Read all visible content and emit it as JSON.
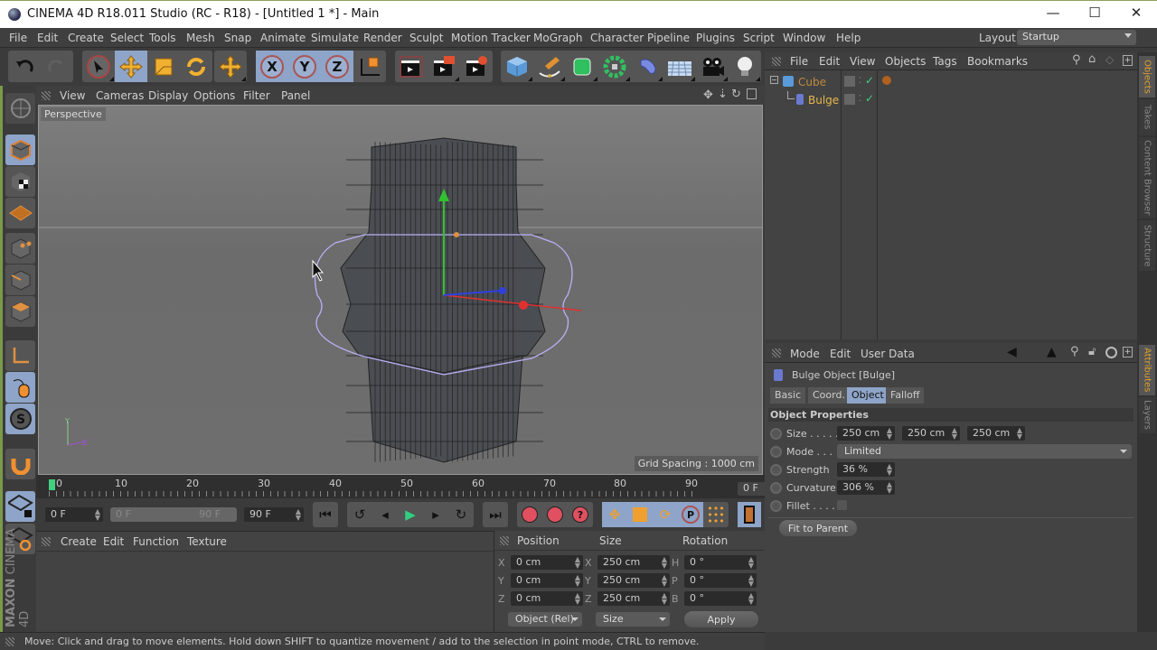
{
  "window": {
    "title": "CINEMA 4D R18.011 Studio (RC - R18) - [Untitled 1 *] - Main",
    "minimize": "—",
    "maximize": "☐",
    "close": "✕"
  },
  "menubar": {
    "items": [
      "File",
      "Edit",
      "Create",
      "Select",
      "Tools",
      "Mesh",
      "Snap",
      "Animate",
      "Simulate",
      "Render",
      "Sculpt",
      "Motion Tracker",
      "MoGraph",
      "Character",
      "Pipeline",
      "Plugins",
      "Script",
      "Window",
      "Help"
    ],
    "layout_label": "Layout:",
    "layout_value": "Startup"
  },
  "toolbar": {
    "axis_x": "X",
    "axis_y": "Y",
    "axis_z": "Z"
  },
  "viewport": {
    "menu": [
      "View",
      "Cameras",
      "Display",
      "Options",
      "Filter",
      "Panel"
    ],
    "camera_label": "Perspective",
    "grid_spacing": "Grid Spacing : 1000 cm",
    "axis_y_label": "Y",
    "axis_z_label": "Z"
  },
  "timeline": {
    "ticks": [
      "0",
      "10",
      "20",
      "30",
      "40",
      "50",
      "60",
      "70",
      "80",
      "90"
    ],
    "current_frame": "0 F",
    "start_field": "0 F",
    "range_start": "0 F",
    "range_end": "90 F",
    "end_field": "90 F"
  },
  "material_manager": {
    "menu": [
      "Create",
      "Edit",
      "Function",
      "Texture"
    ]
  },
  "coordinates": {
    "headers": [
      "Position",
      "Size",
      "Rotation"
    ],
    "rows": [
      {
        "pos_axis": "X",
        "pos": "0 cm",
        "size_axis": "X",
        "size": "250 cm",
        "rot_axis": "H",
        "rot": "0 °"
      },
      {
        "pos_axis": "Y",
        "pos": "0 cm",
        "size_axis": "Y",
        "size": "250 cm",
        "rot_axis": "P",
        "rot": "0 °"
      },
      {
        "pos_axis": "Z",
        "pos": "0 cm",
        "size_axis": "Z",
        "size": "250 cm",
        "rot_axis": "B",
        "rot": "0 °"
      }
    ],
    "mode_select": "Object (Rel)",
    "size_select": "Size",
    "apply": "Apply"
  },
  "status": {
    "text": "Move: Click and drag to move elements. Hold down SHIFT to quantize movement / add to the selection in point mode, CTRL to remove."
  },
  "object_manager": {
    "menu": [
      "File",
      "Edit",
      "View",
      "Objects",
      "Tags",
      "Bookmarks"
    ],
    "objects": [
      {
        "name": "Cube",
        "color": "#c08a40"
      },
      {
        "name": "Bulge",
        "color": "#e6b84a"
      }
    ]
  },
  "attributes": {
    "menu": [
      "Mode",
      "Edit",
      "User Data"
    ],
    "object_title": "Bulge Object [Bulge]",
    "tabs": [
      "Basic",
      "Coord.",
      "Object",
      "Falloff"
    ],
    "active_tab": "Object",
    "section": "Object Properties",
    "size_label": "Size . . . . .",
    "size_values": [
      "250 cm",
      "250 cm",
      "250 cm"
    ],
    "mode_label": "Mode . . .",
    "mode_value": "Limited",
    "strength_label": "Strength",
    "strength_value": "36 %",
    "curvature_label": "Curvature",
    "curvature_value": "306 %",
    "fillet_label": "Fillet . . . .",
    "fillet_checked": false,
    "fit_button": "Fit to Parent"
  },
  "side_tabs": {
    "top": [
      "Objects",
      "Takes",
      "Content Browser",
      "Structure"
    ],
    "bottom": [
      "Attributes",
      "Layers"
    ]
  },
  "branding": {
    "maxon": "MAXON",
    "product": "CINEMA 4D"
  },
  "colors": {
    "accent_active": "#8ea4c8",
    "tab_active_text": "#e0a030",
    "deformer_cage": "#b0a8f0"
  }
}
